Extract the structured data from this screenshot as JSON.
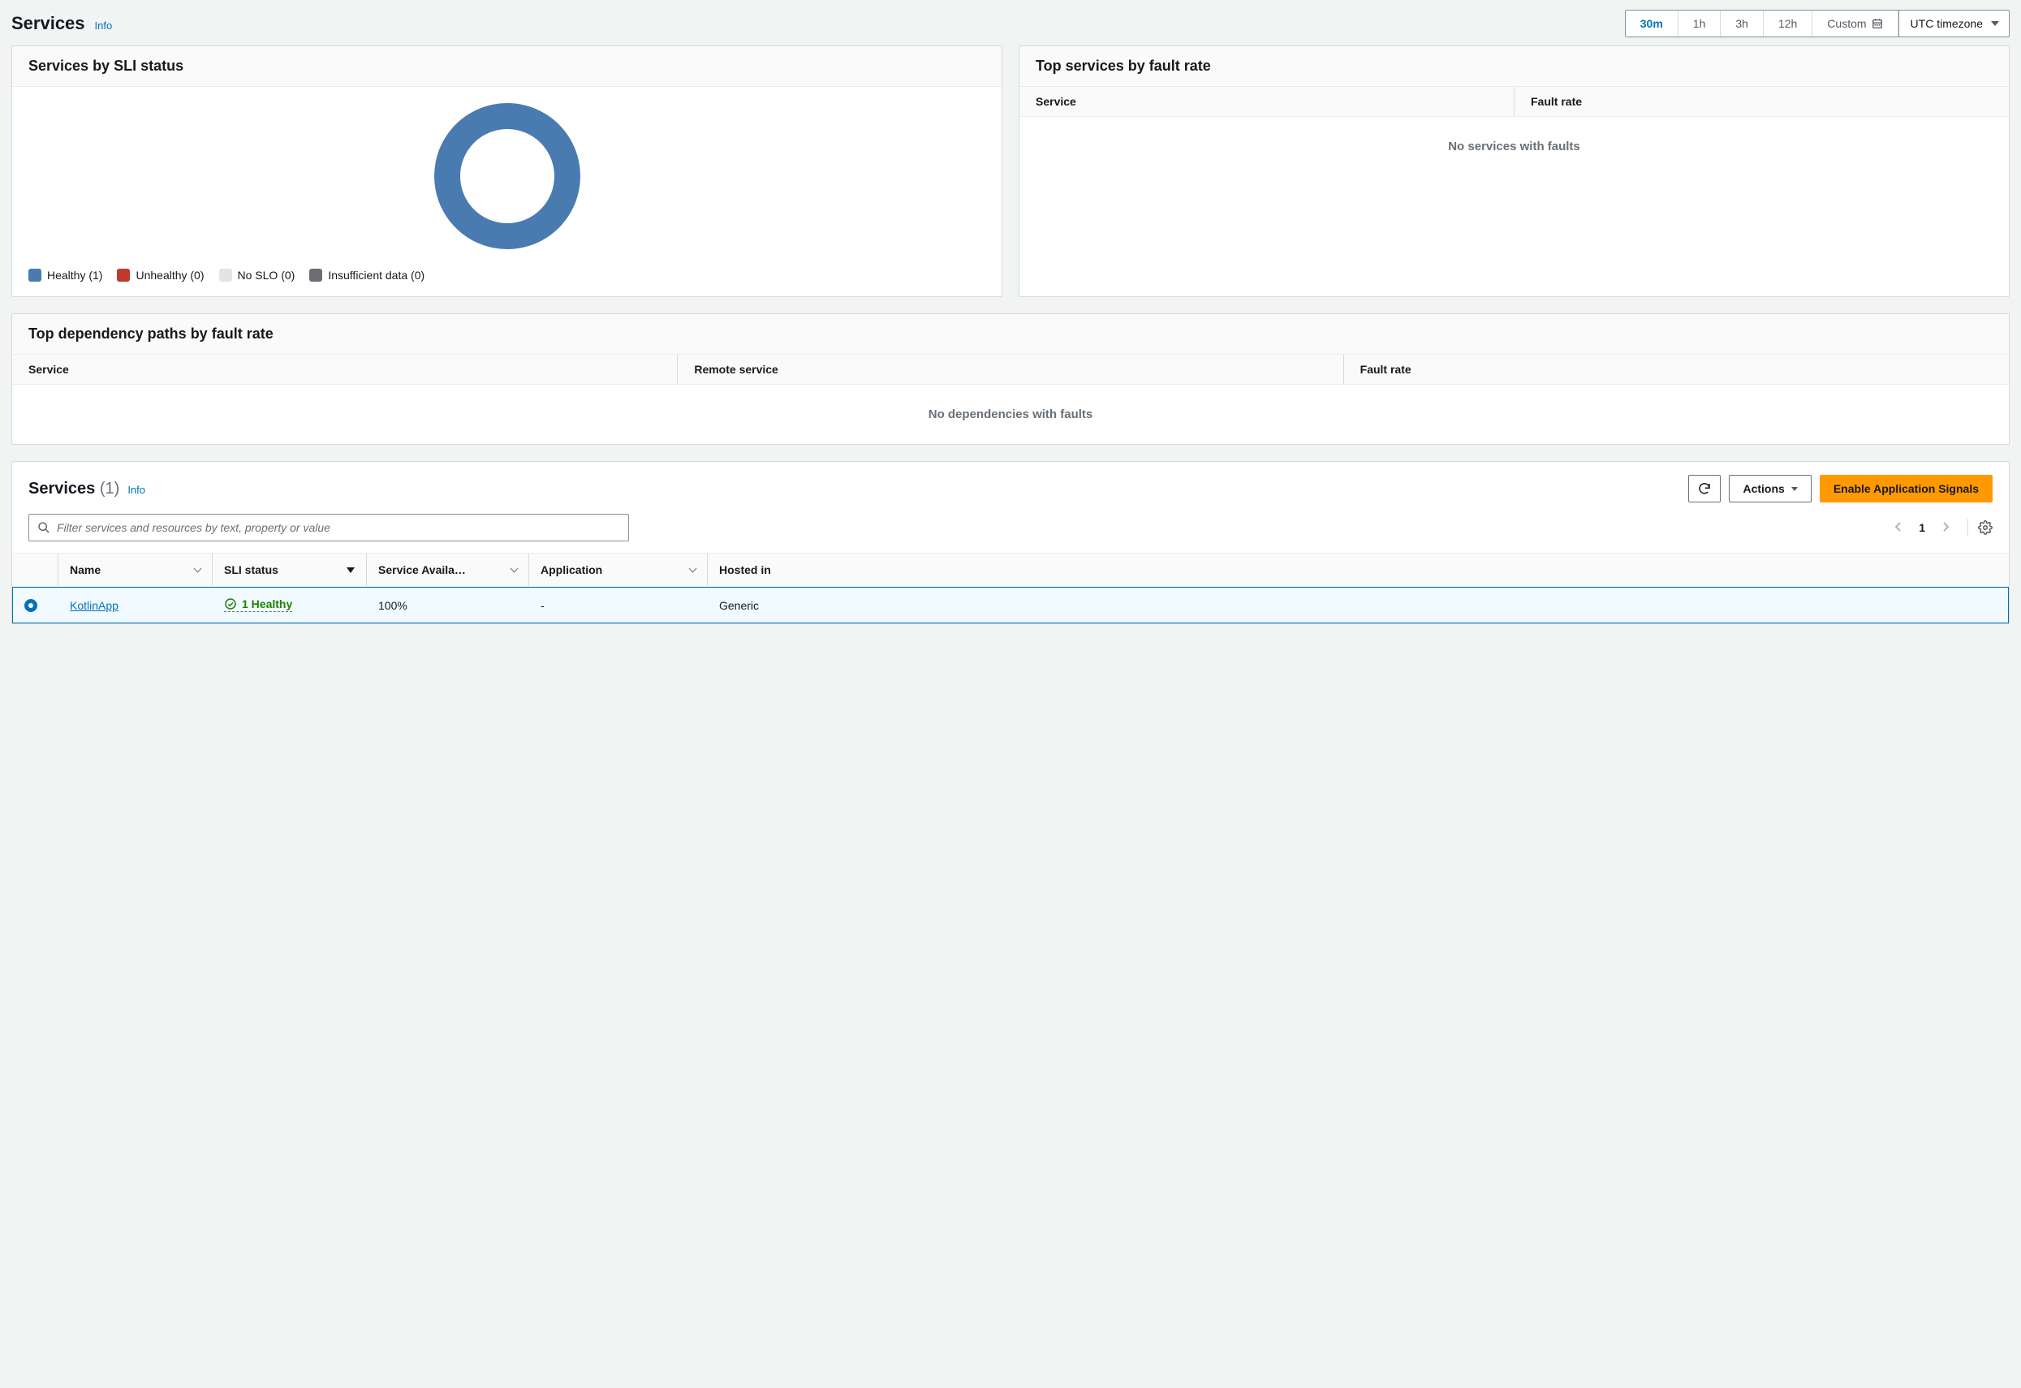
{
  "header": {
    "title": "Services",
    "info": "Info"
  },
  "time": {
    "options": [
      "30m",
      "1h",
      "3h",
      "12h"
    ],
    "active_index": 0,
    "custom_label": "Custom",
    "timezone_label": "UTC timezone"
  },
  "sli_panel": {
    "title": "Services by SLI status",
    "legend": [
      {
        "label": "Healthy (1)",
        "color": "#4a7bb0"
      },
      {
        "label": "Unhealthy (0)",
        "color": "#c0392b"
      },
      {
        "label": "No SLO (0)",
        "color": "#e4e4e4"
      },
      {
        "label": "Insufficient data (0)",
        "color": "#6b6f73"
      }
    ]
  },
  "fault_panel": {
    "title": "Top services by fault rate",
    "columns": [
      "Service",
      "Fault rate"
    ],
    "empty": "No services with faults"
  },
  "dep_panel": {
    "title": "Top dependency paths by fault rate",
    "columns": [
      "Service",
      "Remote service",
      "Fault rate"
    ],
    "empty": "No dependencies with faults"
  },
  "services_table": {
    "title": "Services",
    "count_display": "(1)",
    "info": "Info",
    "actions_label": "Actions",
    "enable_label": "Enable Application Signals",
    "filter_placeholder": "Filter services and resources by text, property or value",
    "page": "1",
    "columns": {
      "name": "Name",
      "sli": "SLI status",
      "avail": "Service Availa…",
      "app": "Application",
      "host": "Hosted in"
    },
    "row": {
      "name": "KotlinApp",
      "sli": "1 Healthy",
      "avail": "100%",
      "app": "-",
      "host": "Generic"
    }
  },
  "chart_data": {
    "type": "pie",
    "title": "Services by SLI status",
    "series": [
      {
        "name": "Healthy",
        "value": 1,
        "color": "#4a7bb0"
      },
      {
        "name": "Unhealthy",
        "value": 0,
        "color": "#c0392b"
      },
      {
        "name": "No SLO",
        "value": 0,
        "color": "#e4e4e4"
      },
      {
        "name": "Insufficient data",
        "value": 0,
        "color": "#6b6f73"
      }
    ]
  }
}
